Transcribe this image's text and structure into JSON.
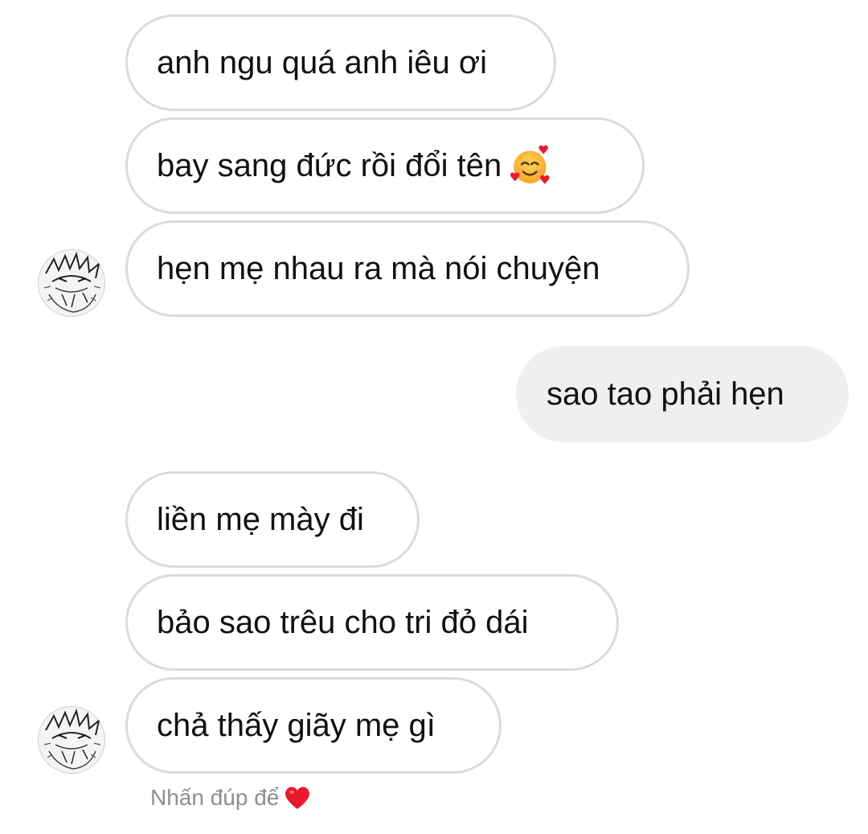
{
  "messages": [
    {
      "text": "anh ngu quá anh iêu ơi",
      "side": "incoming"
    },
    {
      "text": "bay sang đức rồi đổi tên",
      "side": "incoming",
      "emoji": "smiling-face-with-hearts-icon"
    },
    {
      "text": "hẹn mẹ nhau ra mà nói chuyện",
      "side": "incoming"
    },
    {
      "text": "sao tao phải hẹn",
      "side": "outgoing"
    },
    {
      "text": "liền mẹ mày đi",
      "side": "incoming"
    },
    {
      "text": "bảo sao trêu cho tri đỏ dái",
      "side": "incoming"
    },
    {
      "text": "chả thấy giãy mẹ gì",
      "side": "incoming"
    }
  ],
  "hint": {
    "text": "Nhấn đúp để",
    "icon": "red-heart-icon"
  },
  "colors": {
    "incoming_border": "#dbdbdb",
    "outgoing_bg": "#efefef",
    "hint_text": "#8e8e8e",
    "heart": "#e8192c"
  }
}
